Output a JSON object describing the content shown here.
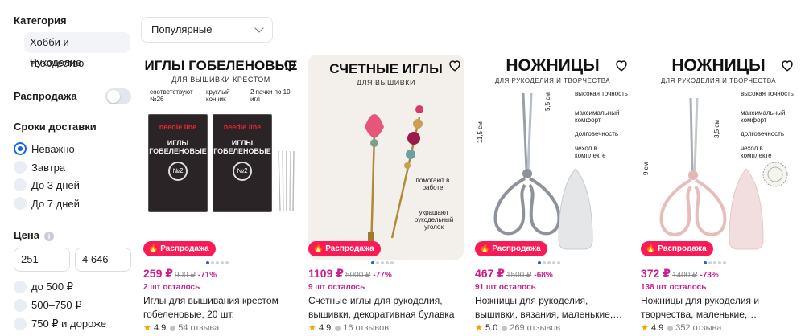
{
  "filters": {
    "category": {
      "heading": "Категория",
      "items": [
        "Хобби и творчество",
        "Рукоделие"
      ]
    },
    "sale": {
      "label": "Распродажа",
      "enabled": false
    },
    "delivery": {
      "heading": "Сроки доставки",
      "options": [
        "Неважно",
        "Завтра",
        "До 3 дней",
        "До 7 дней"
      ],
      "selected": "Неважно"
    },
    "price": {
      "heading": "Цена",
      "min": "251",
      "max": "4 646",
      "ranges": [
        "до 500 ₽",
        "500–750 ₽",
        "750 ₽ и дороже"
      ]
    }
  },
  "sort": {
    "selected": "Популярные"
  },
  "products": [
    {
      "img_title": "ИГЛЫ ГОБЕЛЕНОВЫЕ",
      "img_subtitle": "ДЛЯ ВЫШИВКИ КРЕСТОМ",
      "img_features": [
        "соответствуют №26",
        "круглый кончик",
        "2 пачки по 10 игл"
      ],
      "pack_brand": "needle line",
      "pack_text": "ИГЛЫ ГОБЕЛЕНОВЫЕ",
      "pack_number": "№2",
      "badge": "Распродажа",
      "price": "259 ₽",
      "old_price": "900 ₽",
      "discount": "-71%",
      "left": "2 шт осталось",
      "title": "Иглы для вышивания крестом гобеленовые, 20 шт.",
      "rating": "4.9",
      "reviews": "54 отзыва"
    },
    {
      "img_title": "СЧЕТНЫЕ ИГЛЫ",
      "img_subtitle": "ДЛЯ ВЫШИВКИ",
      "img_features": [
        "помогают в работе",
        "украшают рукодельный уголок"
      ],
      "badge": "Распродажа",
      "price": "1109 ₽",
      "old_price": "5000 ₽",
      "discount": "-77%",
      "left": "9 шт осталось",
      "title": "Счетные иглы для рукоделия, вышивки, декоративная булавка",
      "rating": "4.9",
      "reviews": "16 отзывов"
    },
    {
      "img_title": "НОЖНИЦЫ",
      "img_subtitle": "ДЛЯ РУКОДЕЛИЯ И ТВОРЧЕСТВА",
      "img_features": [
        "высокая точность",
        "максимальный комфорт",
        "долговечность",
        "чехол в комплекте"
      ],
      "dim_a": "5,5 см",
      "dim_b": "11,5 см",
      "badge": "Распродажа",
      "price": "467 ₽",
      "old_price": "1500 ₽",
      "discount": "-68%",
      "left": "91 шт осталось",
      "title": "Ножницы для рукоделия, вышивки, вязания, маленькие,…",
      "rating": "5.0",
      "reviews": "269 отзывов"
    },
    {
      "img_title": "НОЖНИЦЫ",
      "img_subtitle": "ДЛЯ РУКОДЕЛИЯ И ТВОРЧЕСТВА",
      "img_features": [
        "высокая точность",
        "максимальный комфорт",
        "долговечность",
        "чехол в комплекте"
      ],
      "dim_a": "3,5 см",
      "dim_b": "9 см",
      "badge": "Распродажа",
      "price": "372 ₽",
      "old_price": "1400 ₽",
      "discount": "-73%",
      "left": "138 шт осталось",
      "title": "Ножницы для рукоделия и творчества, маленькие,…",
      "rating": "4.9",
      "reviews": "352 отзыва"
    }
  ],
  "colors": {
    "accent": "#1764e8",
    "sale_badge": "#f91b55",
    "price": "#cc1d8c",
    "star": "#f6a000"
  }
}
